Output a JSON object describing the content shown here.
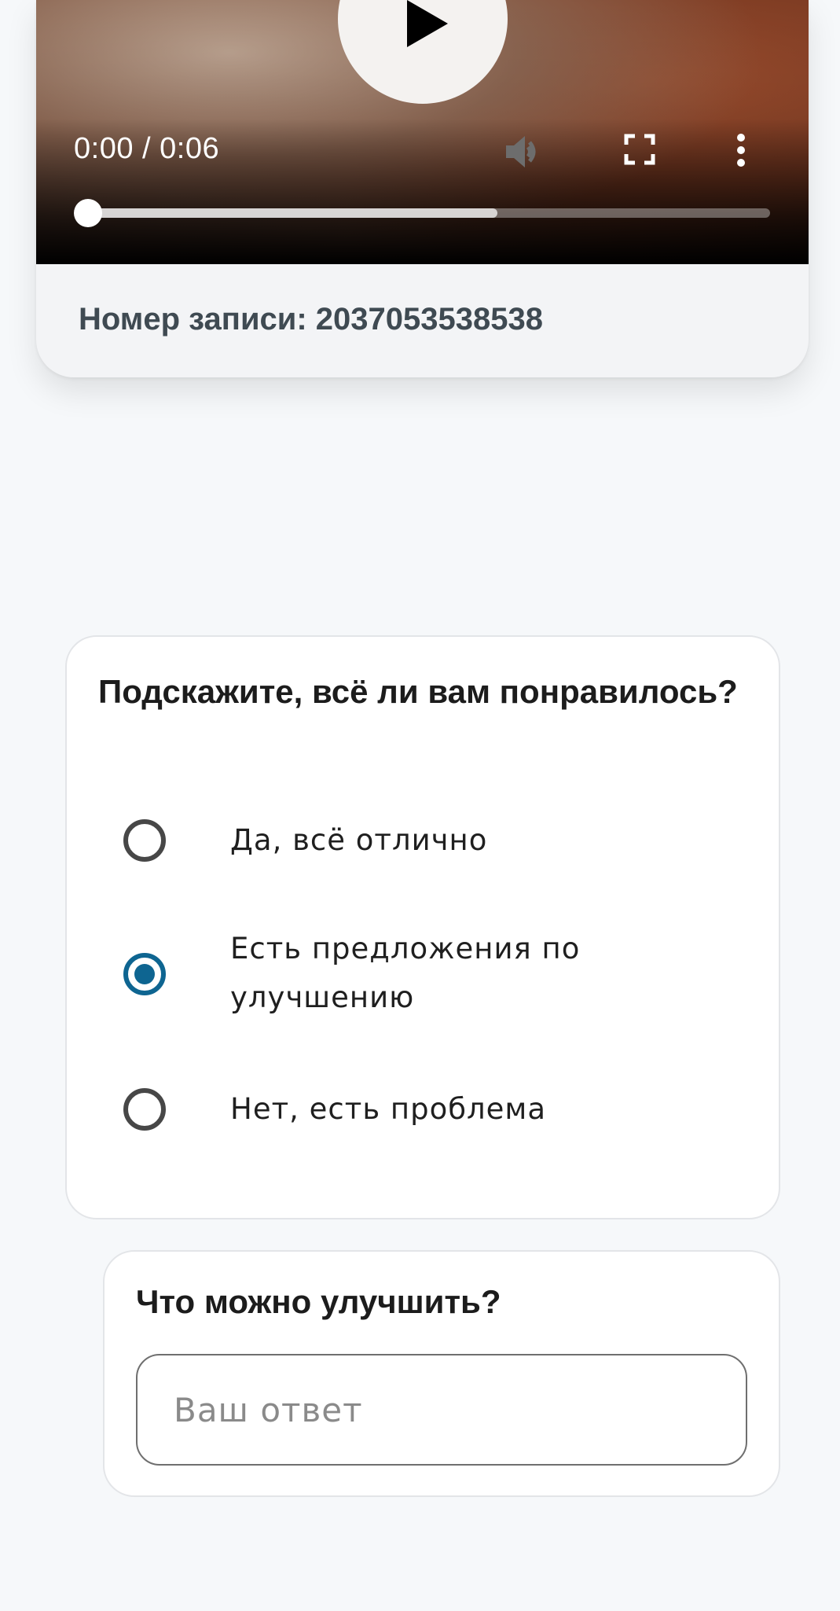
{
  "video": {
    "time_display": "0:00 / 0:06",
    "progress_fraction": 0.0,
    "buffered_fraction": 0.6,
    "record_number": "Номер записи: 2037053538538"
  },
  "survey": {
    "question": "Подскажите, всё ли вам понравилось?",
    "options": [
      {
        "label": "Да, всё отлично",
        "checked": false
      },
      {
        "label": "Есть предложения по улучшению",
        "checked": true
      },
      {
        "label": "Нет, есть проблема",
        "checked": false
      }
    ]
  },
  "improve": {
    "title": "Что можно улучшить?",
    "placeholder": "Ваш ответ",
    "value": ""
  },
  "colors": {
    "accent": "#0e6591",
    "radio_unchecked": "#474747",
    "background": "#f6f8fa"
  }
}
